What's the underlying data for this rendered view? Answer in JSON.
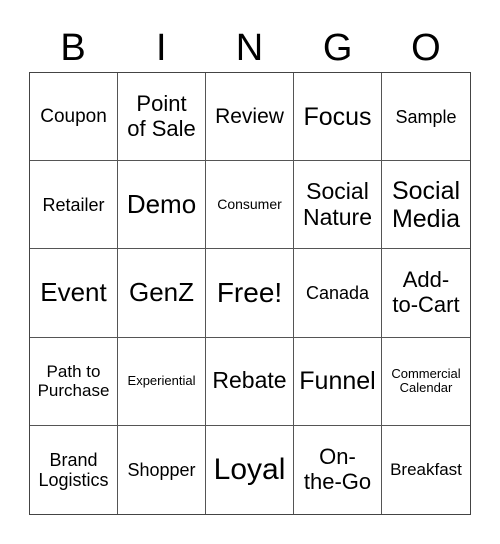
{
  "header": {
    "letters": [
      "B",
      "I",
      "N",
      "G",
      "O"
    ]
  },
  "board": {
    "rows": [
      [
        "Coupon",
        "Point\nof Sale",
        "Review",
        "Focus",
        "Sample"
      ],
      [
        "Retailer",
        "Demo",
        "Consumer",
        "Social\nNature",
        "Social\nMedia"
      ],
      [
        "Event",
        "GenZ",
        "Free!",
        "Canada",
        "Add-\nto-Cart"
      ],
      [
        "Path to\nPurchase",
        "Experiential",
        "Rebate",
        "Funnel",
        "Commercial\nCalendar"
      ],
      [
        "Brand\nLogistics",
        "Shopper",
        "Loyal",
        "On-\nthe-Go",
        "Breakfast"
      ]
    ]
  },
  "colors": {
    "grid_line": "#555555",
    "text": "#000000",
    "background": "#ffffff"
  }
}
